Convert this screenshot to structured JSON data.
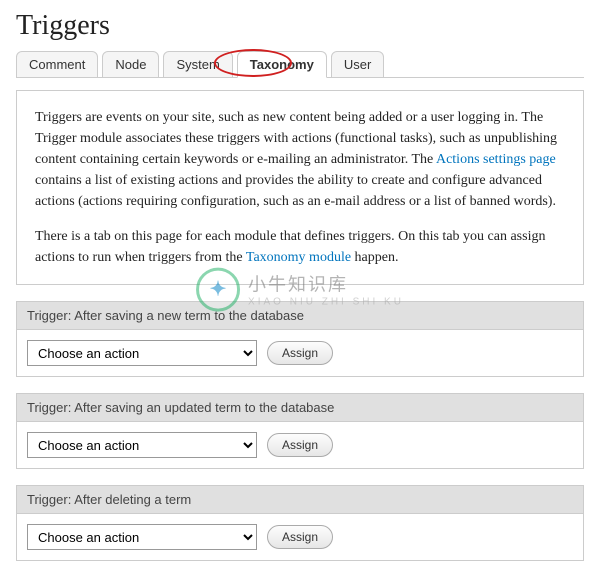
{
  "page_title": "Triggers",
  "tabs": {
    "comment": "Comment",
    "node": "Node",
    "system": "System",
    "taxonomy": "Taxonomy",
    "user": "User"
  },
  "active_tab": "taxonomy",
  "description": {
    "p1_before_link": "Triggers are events on your site, such as new content being added or a user logging in. The Trigger module associates these triggers with actions (functional tasks), such as unpublishing content containing certain keywords or e-mailing an administrator. The ",
    "link1_text": "Actions settings page",
    "p1_after_link": " contains a list of existing actions and provides the ability to create and configure advanced actions (actions requiring configuration, such as an e-mail address or a list of banned words).",
    "p2_before_link": "There is a tab on this page for each module that defines triggers. On this tab you can assign actions to run when triggers from the ",
    "link2_text": "Taxonomy module",
    "p2_after_link": " happen."
  },
  "triggers": [
    {
      "header": "Trigger: After saving a new term to the database",
      "select_value": "Choose an action",
      "button": "Assign"
    },
    {
      "header": "Trigger: After saving an updated term to the database",
      "select_value": "Choose an action",
      "button": "Assign"
    },
    {
      "header": "Trigger: After deleting a term",
      "select_value": "Choose an action",
      "button": "Assign"
    }
  ],
  "watermark": {
    "cn": "小牛知识库",
    "en": "XIAO NIU ZHI SHI KU"
  }
}
